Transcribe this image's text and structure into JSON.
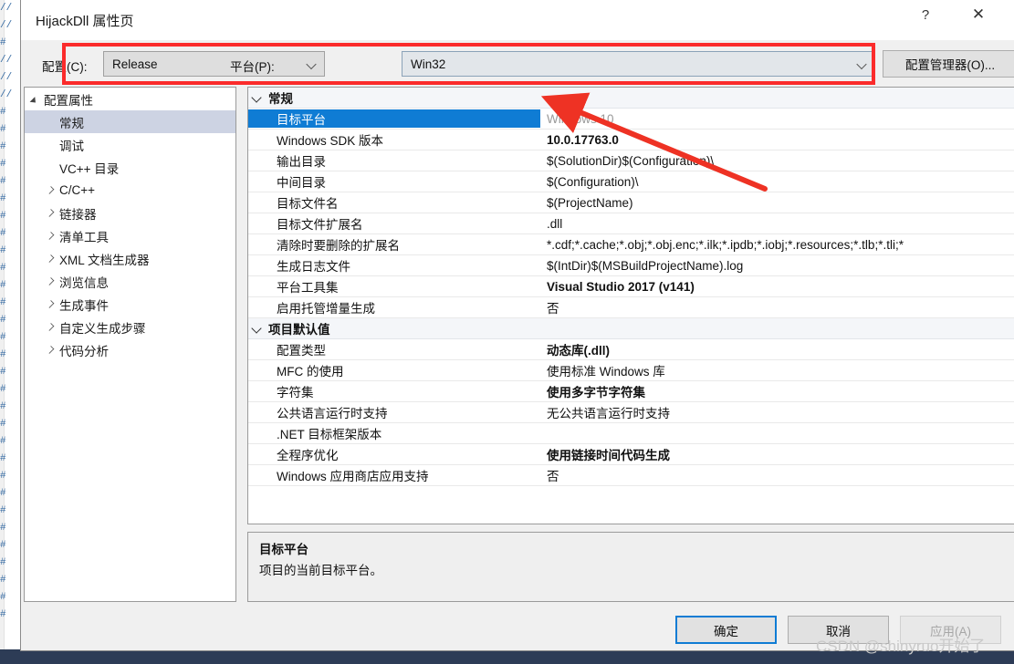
{
  "window": {
    "title": "HijackDll 属性页",
    "help_label": "?",
    "close_label": "✕"
  },
  "config_bar": {
    "config_label": "配置(C):",
    "config_value": "Release",
    "platform_label": "平台(P):",
    "platform_value": "Win32",
    "config_manager_button": "配置管理器(O)...",
    "highlight_color": "#fb2b2b"
  },
  "tree": {
    "items": [
      {
        "label": "配置属性",
        "level": 0,
        "state": "expanded",
        "selected": false
      },
      {
        "label": "常规",
        "level": 1,
        "state": "leaf",
        "selected": true
      },
      {
        "label": "调试",
        "level": 1,
        "state": "leaf",
        "selected": false
      },
      {
        "label": "VC++ 目录",
        "level": 1,
        "state": "leaf",
        "selected": false
      },
      {
        "label": "C/C++",
        "level": 1,
        "state": "collapsed",
        "selected": false
      },
      {
        "label": "链接器",
        "level": 1,
        "state": "collapsed",
        "selected": false
      },
      {
        "label": "清单工具",
        "level": 1,
        "state": "collapsed",
        "selected": false
      },
      {
        "label": "XML 文档生成器",
        "level": 1,
        "state": "collapsed",
        "selected": false
      },
      {
        "label": "浏览信息",
        "level": 1,
        "state": "collapsed",
        "selected": false
      },
      {
        "label": "生成事件",
        "level": 1,
        "state": "collapsed",
        "selected": false
      },
      {
        "label": "自定义生成步骤",
        "level": 1,
        "state": "collapsed",
        "selected": false
      },
      {
        "label": "代码分析",
        "level": 1,
        "state": "collapsed",
        "selected": false
      }
    ]
  },
  "grid": {
    "rows": [
      {
        "kind": "category",
        "name": "常规",
        "value": ""
      },
      {
        "kind": "prop",
        "name": "目标平台",
        "value": "Windows 10",
        "style": "muted",
        "selected": true
      },
      {
        "kind": "prop",
        "name": "Windows SDK 版本",
        "value": "10.0.17763.0",
        "style": "bold"
      },
      {
        "kind": "prop",
        "name": "输出目录",
        "value": "$(SolutionDir)$(Configuration)\\",
        "style": "normal"
      },
      {
        "kind": "prop",
        "name": "中间目录",
        "value": "$(Configuration)\\",
        "style": "normal"
      },
      {
        "kind": "prop",
        "name": "目标文件名",
        "value": "$(ProjectName)",
        "style": "normal"
      },
      {
        "kind": "prop",
        "name": "目标文件扩展名",
        "value": ".dll",
        "style": "normal"
      },
      {
        "kind": "prop",
        "name": "清除时要删除的扩展名",
        "value": "*.cdf;*.cache;*.obj;*.obj.enc;*.ilk;*.ipdb;*.iobj;*.resources;*.tlb;*.tli;*",
        "style": "normal"
      },
      {
        "kind": "prop",
        "name": "生成日志文件",
        "value": "$(IntDir)$(MSBuildProjectName).log",
        "style": "normal"
      },
      {
        "kind": "prop",
        "name": "平台工具集",
        "value": "Visual Studio 2017 (v141)",
        "style": "bold"
      },
      {
        "kind": "prop",
        "name": "启用托管增量生成",
        "value": "否",
        "style": "normal"
      },
      {
        "kind": "category",
        "name": "项目默认值",
        "value": ""
      },
      {
        "kind": "prop",
        "name": "配置类型",
        "value": "动态库(.dll)",
        "style": "bold"
      },
      {
        "kind": "prop",
        "name": "MFC 的使用",
        "value": "使用标准 Windows 库",
        "style": "normal"
      },
      {
        "kind": "prop",
        "name": "字符集",
        "value": "使用多字节字符集",
        "style": "bold"
      },
      {
        "kind": "prop",
        "name": "公共语言运行时支持",
        "value": "无公共语言运行时支持",
        "style": "normal"
      },
      {
        "kind": "prop",
        "name": ".NET 目标框架版本",
        "value": "",
        "style": "normal"
      },
      {
        "kind": "prop",
        "name": "全程序优化",
        "value": "使用链接时间代码生成",
        "style": "bold"
      },
      {
        "kind": "prop",
        "name": "Windows 应用商店应用支持",
        "value": "否",
        "style": "normal"
      }
    ],
    "selection_color": "#0f7cd4"
  },
  "description": {
    "title": "目标平台",
    "body": "项目的当前目标平台。"
  },
  "footer": {
    "ok": "确定",
    "cancel": "取消",
    "apply": "应用(A)"
  },
  "annotations": {
    "watermark": "CSDN @shinyruo开始了",
    "arrow_color": "#ee3224"
  },
  "background": {
    "left_code": "//\n//\n#\n//\n//\n//\n#\n#\n#\n#\n#\n#\n#\n#\n#\n#\n#\n#\n#\n#\n#\n#\n#\n#\n#\n#\n#\n#\n#\n#\n#\n#\n#\n#\n#\n#",
    "right_marks": [
      "@",
      "@"
    ]
  }
}
